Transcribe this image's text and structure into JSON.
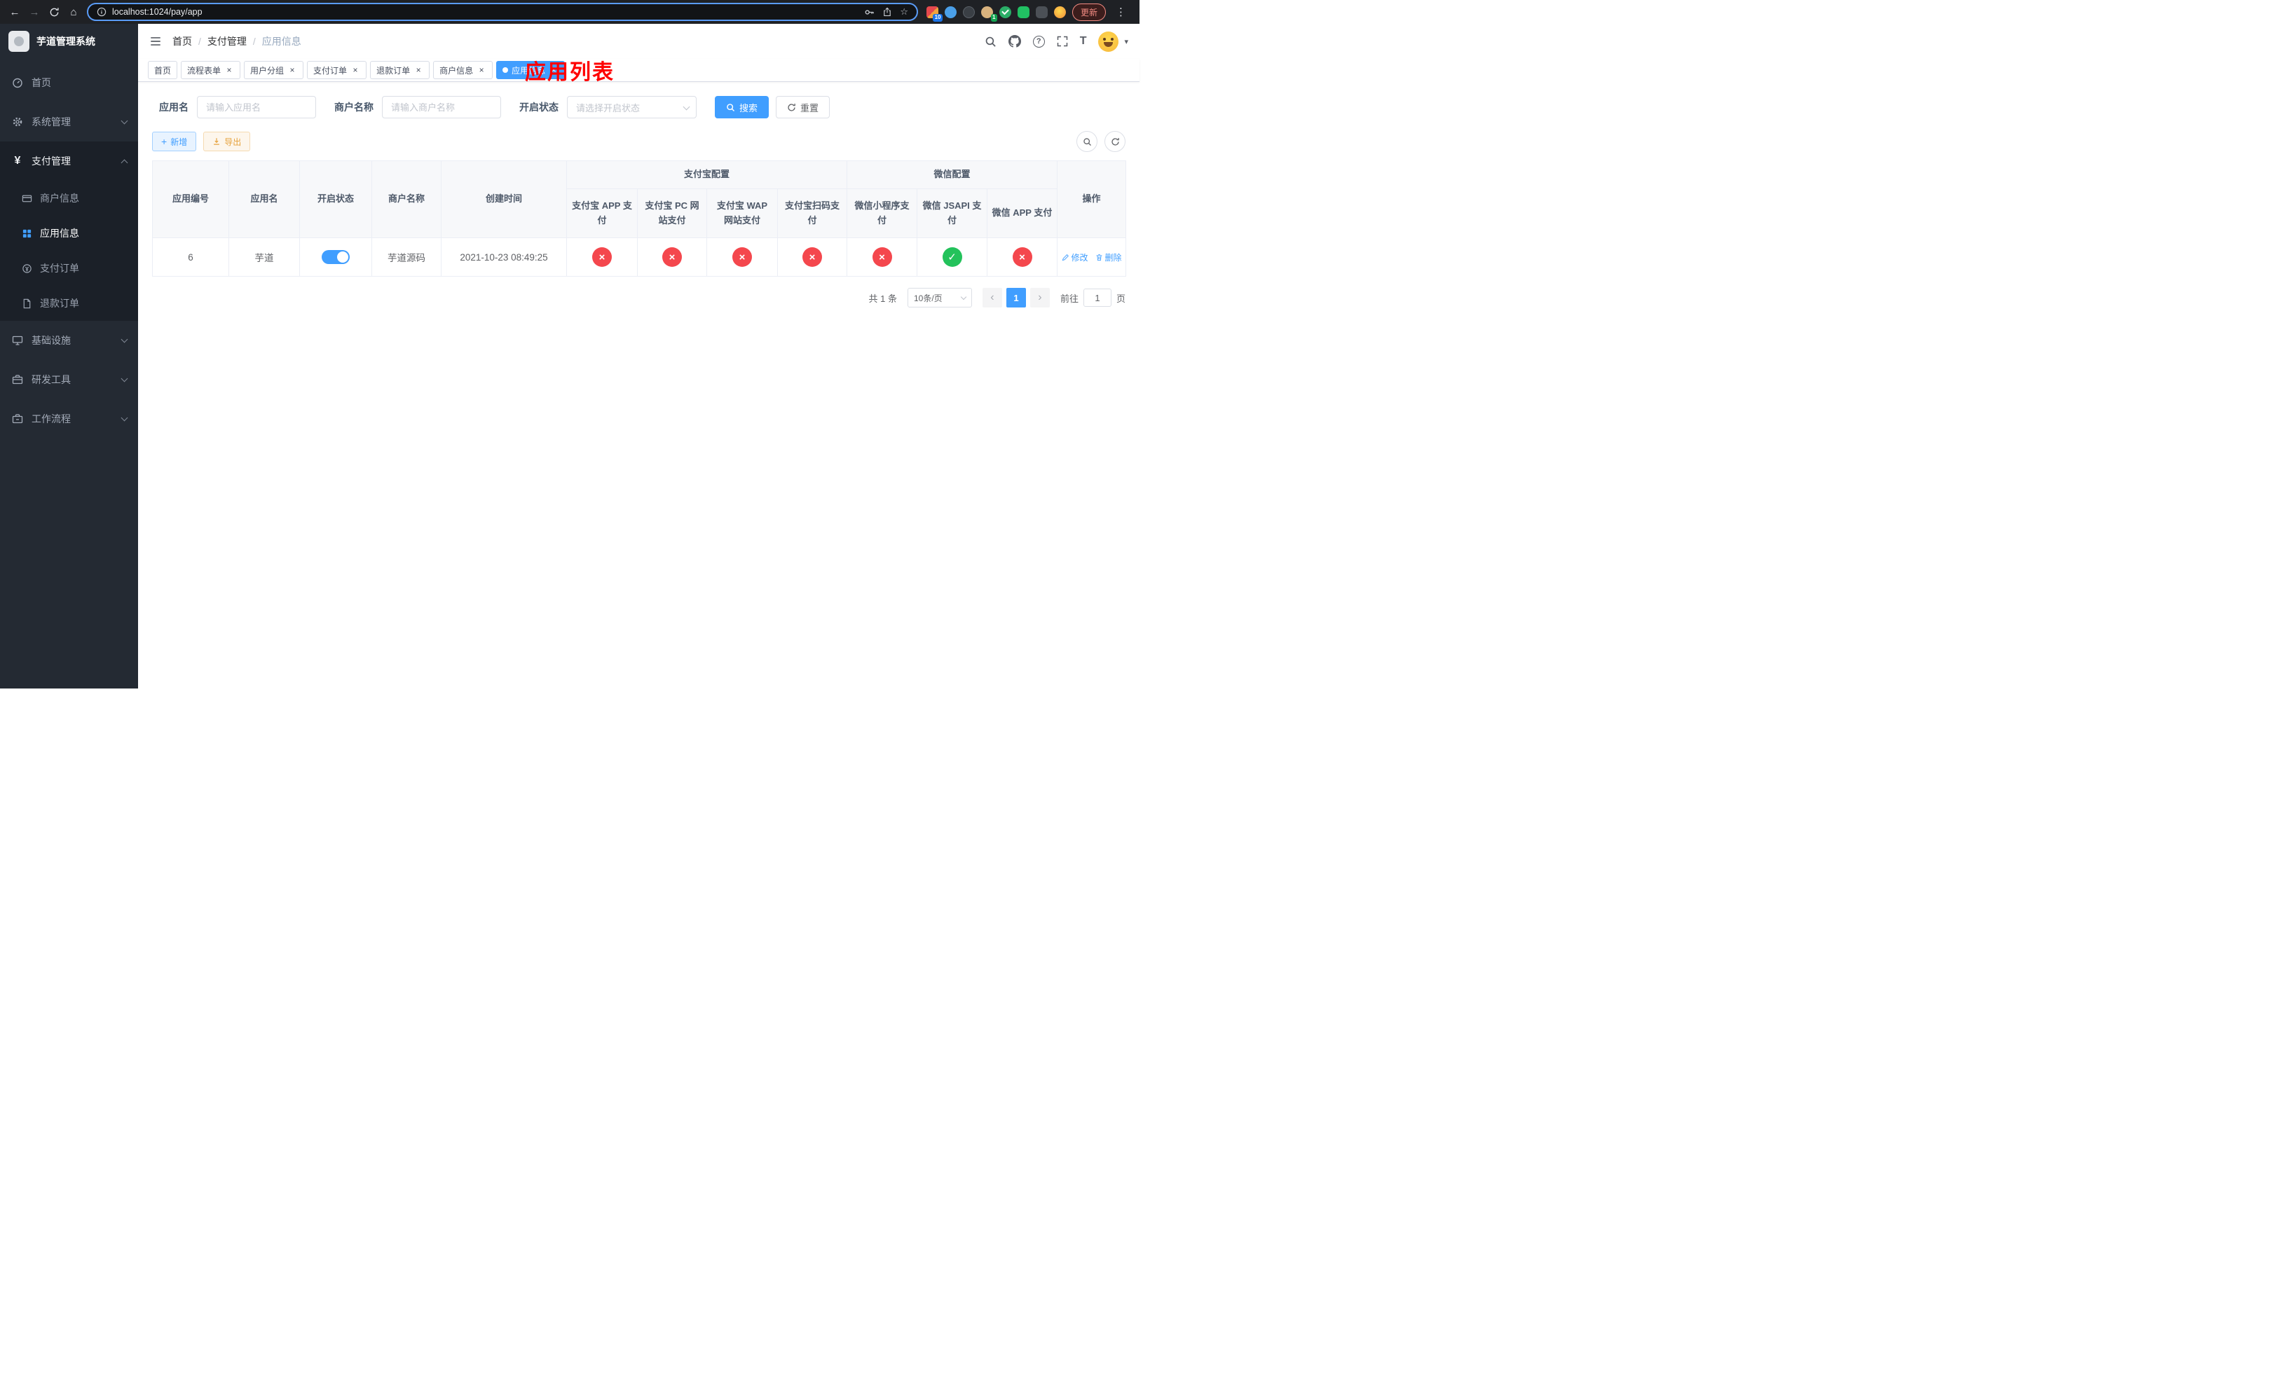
{
  "colors": {
    "accent": "#409eff",
    "success": "#23c25b",
    "danger": "#f4474d",
    "warning": "#e6a23c",
    "overlay_title_red": "#ff0000",
    "sidebar_bg": "#242a33",
    "submenu_bg": "#1b2028"
  },
  "icons": {
    "back": "←",
    "forward": "→",
    "home": "⌂",
    "star": "☆",
    "menu_dots": "⋮",
    "tab_close": "×",
    "plus": "+",
    "yen": "¥",
    "status_ok": "✓",
    "status_no": "×",
    "caret_down": "▾",
    "prev": "‹",
    "next": "›",
    "help": "?",
    "font_size": "T"
  },
  "browser": {
    "url": "localhost:1024/pay/app",
    "update_label": "更新",
    "extensions_badge": "10",
    "profile_badge": "1"
  },
  "sidebar": {
    "title": "芋道管理系统",
    "menu": [
      {
        "label": "首页"
      },
      {
        "label": "系统管理"
      },
      {
        "label": "支付管理"
      },
      {
        "label": "基础设施"
      },
      {
        "label": "研发工具"
      },
      {
        "label": "工作流程"
      }
    ],
    "submenu": [
      {
        "label": "商户信息"
      },
      {
        "label": "应用信息"
      },
      {
        "label": "支付订单"
      },
      {
        "label": "退款订单"
      }
    ]
  },
  "header": {
    "breadcrumb": [
      "首页",
      "支付管理",
      "应用信息"
    ],
    "overlay_title": "应用列表"
  },
  "tabs": [
    {
      "label": "首页"
    },
    {
      "label": "流程表单"
    },
    {
      "label": "用户分组"
    },
    {
      "label": "支付订单"
    },
    {
      "label": "退款订单"
    },
    {
      "label": "商户信息"
    },
    {
      "label": "应用信息"
    }
  ],
  "filters": {
    "app_name_label": "应用名",
    "app_name_placeholder": "请输入应用名",
    "merchant_label": "商户名称",
    "merchant_placeholder": "请输入商户名称",
    "status_label": "开启状态",
    "status_placeholder": "请选择开启状态",
    "search_label": "搜索",
    "reset_label": "重置"
  },
  "toolbar": {
    "add_label": "新增",
    "export_label": "导出"
  },
  "table": {
    "group_headers": {
      "alipay": "支付宝配置",
      "wechat": "微信配置"
    },
    "columns": {
      "app_id": "应用编号",
      "app_name": "应用名",
      "status": "开启状态",
      "merchant": "商户名称",
      "created": "创建时间",
      "alipay_app": "支付宝 APP 支付",
      "alipay_pc": "支付宝 PC 网站支付",
      "alipay_wap": "支付宝 WAP 网站支付",
      "alipay_qr": "支付宝扫码支付",
      "wechat_mini": "微信小程序支付",
      "wechat_jsapi": "微信 JSAPI 支付",
      "wechat_app": "微信 APP 支付",
      "actions": "操作"
    },
    "rows": [
      {
        "app_id": "6",
        "app_name": "芋道",
        "enabled": true,
        "merchant": "芋道源码",
        "created": "2021-10-23 08:49:25",
        "statuses": [
          false,
          false,
          false,
          false,
          false,
          true,
          false
        ],
        "edit_label": "修改",
        "delete_label": "删除"
      }
    ]
  },
  "pagination": {
    "total": "共 1 条",
    "page_size": "10条/页",
    "current_page": "1",
    "goto_label": "前往",
    "goto_value": "1",
    "goto_suffix": "页"
  }
}
